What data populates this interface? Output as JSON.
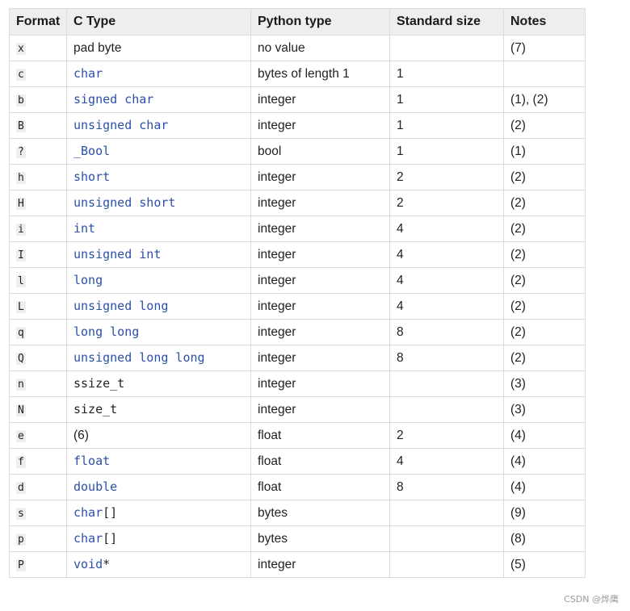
{
  "headers": [
    "Format",
    "C Type",
    "Python type",
    "Standard size",
    "Notes"
  ],
  "rows": [
    {
      "format": "x",
      "ctype": "",
      "ctype_text": "pad byte",
      "python_type": "no value",
      "size": "",
      "notes": "(7)"
    },
    {
      "format": "c",
      "ctype": "char",
      "ctype_text": "",
      "python_type": "bytes of length 1",
      "size": "1",
      "notes": ""
    },
    {
      "format": "b",
      "ctype": "signed char",
      "ctype_text": "",
      "python_type": "integer",
      "size": "1",
      "notes": "(1), (2)"
    },
    {
      "format": "B",
      "ctype": "unsigned char",
      "ctype_text": "",
      "python_type": "integer",
      "size": "1",
      "notes": "(2)"
    },
    {
      "format": "?",
      "ctype": "_Bool",
      "ctype_text": "",
      "python_type": "bool",
      "size": "1",
      "notes": "(1)"
    },
    {
      "format": "h",
      "ctype": "short",
      "ctype_text": "",
      "python_type": "integer",
      "size": "2",
      "notes": "(2)"
    },
    {
      "format": "H",
      "ctype": "unsigned short",
      "ctype_text": "",
      "python_type": "integer",
      "size": "2",
      "notes": "(2)"
    },
    {
      "format": "i",
      "ctype": "int",
      "ctype_text": "",
      "python_type": "integer",
      "size": "4",
      "notes": "(2)"
    },
    {
      "format": "I",
      "ctype": "unsigned int",
      "ctype_text": "",
      "python_type": "integer",
      "size": "4",
      "notes": "(2)"
    },
    {
      "format": "l",
      "ctype": "long",
      "ctype_text": "",
      "python_type": "integer",
      "size": "4",
      "notes": "(2)"
    },
    {
      "format": "L",
      "ctype": "unsigned long",
      "ctype_text": "",
      "python_type": "integer",
      "size": "4",
      "notes": "(2)"
    },
    {
      "format": "q",
      "ctype": "long long",
      "ctype_text": "",
      "python_type": "integer",
      "size": "8",
      "notes": "(2)"
    },
    {
      "format": "Q",
      "ctype": "unsigned long long",
      "ctype_text": "",
      "python_type": "integer",
      "size": "8",
      "notes": "(2)"
    },
    {
      "format": "n",
      "ctype": "ssize_t",
      "ctype_plain": true,
      "ctype_text": "",
      "python_type": "integer",
      "size": "",
      "notes": "(3)"
    },
    {
      "format": "N",
      "ctype": "size_t",
      "ctype_plain": true,
      "ctype_text": "",
      "python_type": "integer",
      "size": "",
      "notes": "(3)"
    },
    {
      "format": "e",
      "ctype": "",
      "ctype_text": "(6)",
      "python_type": "float",
      "size": "2",
      "notes": "(4)"
    },
    {
      "format": "f",
      "ctype": "float",
      "ctype_text": "",
      "python_type": "float",
      "size": "4",
      "notes": "(4)"
    },
    {
      "format": "d",
      "ctype": "double",
      "ctype_text": "",
      "python_type": "float",
      "size": "8",
      "notes": "(4)"
    },
    {
      "format": "s",
      "ctype": "char",
      "ctype_suffix": "[]",
      "ctype_text": "",
      "python_type": "bytes",
      "size": "",
      "notes": "(9)"
    },
    {
      "format": "p",
      "ctype": "char",
      "ctype_suffix": "[]",
      "ctype_text": "",
      "python_type": "bytes",
      "size": "",
      "notes": "(8)"
    },
    {
      "format": "P",
      "ctype": "void",
      "ctype_suffix": "*",
      "ctype_text": "",
      "python_type": "integer",
      "size": "",
      "notes": "(5)"
    }
  ],
  "watermark": "CSDN @烨鹰",
  "colors": {
    "ctype_link": "#2c4fa8",
    "header_bg": "#eeeeee",
    "border": "#dcdcdc"
  }
}
